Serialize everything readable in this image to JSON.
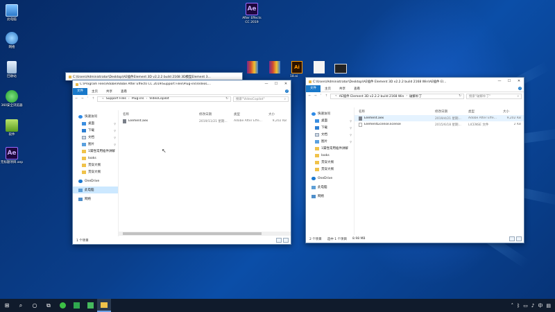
{
  "desktop_icons": [
    {
      "name": "this-pc-icon",
      "label": "此电脑"
    },
    {
      "name": "network-icon",
      "label": "网络"
    },
    {
      "name": "recycle-bin-icon",
      "label": "回收站"
    },
    {
      "name": "browser-360-icon",
      "label": "360安全浏览器"
    },
    {
      "name": "software-folder-icon",
      "label": "软件"
    },
    {
      "name": "aep-file-icon",
      "label": "无标题项目.aep",
      "glyph": "Ae"
    },
    {
      "name": "after-effects-icon",
      "label": "After Effects CC 2019",
      "glyph": "Ae"
    }
  ],
  "desktop_mini": {
    "ai_label": "18.ai",
    "ai_glyph": "Ai"
  },
  "left_window": {
    "title": "C:\\Users\\Administrator\\Desktop\\AE插件Element 3D v2.2.2 build 2168 3D模型Element 3...",
    "front_title": "C:\\Program Files\\Adobe\\Adobe After Effects CC 2019\\Support Files\\Plug-ins\\VideoC...",
    "ribbon": {
      "file": "文件",
      "home": "主页",
      "share": "共享",
      "view": "查看"
    },
    "path": [
      "Support Files",
      "Plug-ins",
      "VideoCopilot"
    ],
    "search_placeholder": "搜索\"VideoCopilot\"",
    "nav": [
      {
        "label": "快速访问",
        "icon": "star-icon",
        "sub": false,
        "pin": false
      },
      {
        "label": "桌面",
        "icon": "desktop-icon",
        "sub": true,
        "pin": true
      },
      {
        "label": "下载",
        "icon": "download-icon",
        "sub": true,
        "pin": true
      },
      {
        "label": "文档",
        "icon": "document-icon",
        "sub": true,
        "pin": true
      },
      {
        "label": "图片",
        "icon": "picture-icon",
        "sub": true,
        "pin": true
      },
      {
        "label": "1属性常用插件讲解",
        "icon": "folder-icon",
        "sub": true,
        "pin": false
      },
      {
        "label": "looks",
        "icon": "folder-icon",
        "sub": true,
        "pin": false
      },
      {
        "label": "贯穿大纲",
        "icon": "folder-icon",
        "sub": true,
        "pin": false
      },
      {
        "label": "贯穿大纲",
        "icon": "folder-icon",
        "sub": true,
        "pin": false
      },
      {
        "label": "OneDrive",
        "icon": "cloud-icon",
        "sub": false,
        "pin": false
      },
      {
        "label": "此电脑",
        "icon": "computer-icon",
        "sub": false,
        "pin": false,
        "selected": true
      },
      {
        "label": "网络",
        "icon": "network-icon",
        "sub": false,
        "pin": false
      }
    ],
    "columns": {
      "name": "名称",
      "date": "修改日期",
      "type": "类型",
      "size": "大小"
    },
    "files": [
      {
        "name": "Element.aex",
        "date": "2019/11/21 星期...",
        "type": "Adobe After Effe...",
        "size": "9,202 KB"
      }
    ],
    "status": {
      "count": "1 个项目"
    }
  },
  "right_window": {
    "title": "C:\\Users\\Administrator\\Desktop\\AE插件 Element 3D v2.2.2 build 2168 Win\\AE插件 El...",
    "ribbon": {
      "file": "文件",
      "home": "主页",
      "share": "共享",
      "view": "查看"
    },
    "path": [
      "AE插件 Element 3D v2.2.2 build 2168 Win",
      "破解补丁"
    ],
    "search_placeholder": "搜索\"破解补丁\"",
    "nav": [
      {
        "label": "快速访问",
        "icon": "star-icon",
        "sub": false,
        "pin": false
      },
      {
        "label": "桌面",
        "icon": "desktop-icon",
        "sub": true,
        "pin": true
      },
      {
        "label": "下载",
        "icon": "download-icon",
        "sub": true,
        "pin": true
      },
      {
        "label": "文档",
        "icon": "document-icon",
        "sub": true,
        "pin": true
      },
      {
        "label": "图片",
        "icon": "picture-icon",
        "sub": true,
        "pin": true
      },
      {
        "label": "1属性常用插件讲解",
        "icon": "folder-icon",
        "sub": true,
        "pin": false
      },
      {
        "label": "looks",
        "icon": "folder-icon",
        "sub": true,
        "pin": false
      },
      {
        "label": "贯穿大纲",
        "icon": "folder-icon",
        "sub": true,
        "pin": false
      },
      {
        "label": "贯穿大纲",
        "icon": "folder-icon",
        "sub": true,
        "pin": false
      },
      {
        "label": "OneDrive",
        "icon": "cloud-icon",
        "sub": false,
        "pin": false
      },
      {
        "label": "此电脑",
        "icon": "computer-icon",
        "sub": false,
        "pin": false
      },
      {
        "label": "网络",
        "icon": "network-icon",
        "sub": false,
        "pin": false
      }
    ],
    "columns": {
      "name": "名称",
      "date": "修改日期",
      "type": "类型",
      "size": "大小"
    },
    "files": [
      {
        "name": "Element.aex",
        "date": "2019/4/21 星期...",
        "type": "Adobe After Effe...",
        "size": "9,202 KB",
        "selected": true
      },
      {
        "name": "ElementLicense.license",
        "date": "2015/6/18 星期...",
        "type": "LICENSE 文件",
        "size": "2 KB"
      }
    ],
    "status": {
      "count": "2 个项目",
      "selected": "选中 1 个项目",
      "size": "8.98 MB"
    }
  },
  "colors": {
    "accent": "#1979ca",
    "taskbar": "#101b2c",
    "selection": "#cce8ff"
  }
}
